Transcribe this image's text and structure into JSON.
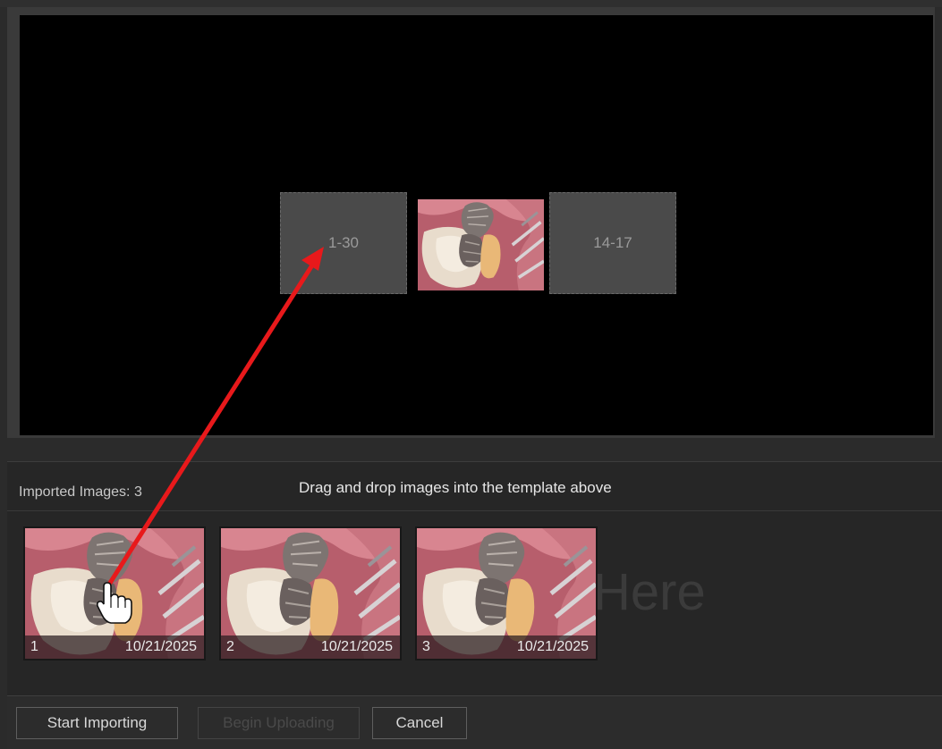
{
  "template": {
    "slots": [
      {
        "label": "1-30"
      },
      {
        "label": "14-17"
      }
    ]
  },
  "imported": {
    "count_label": "Imported Images: 3",
    "hint": "Drag and drop images into the template above",
    "watermark": "Here",
    "thumbnails": [
      {
        "number": "1",
        "date": "10/21/2025"
      },
      {
        "number": "2",
        "date": "10/21/2025"
      },
      {
        "number": "3",
        "date": "10/21/2025"
      }
    ]
  },
  "footer": {
    "start_label": "Start Importing",
    "upload_label": "Begin Uploading",
    "cancel_label": "Cancel"
  },
  "colors": {
    "arrow": "#e8191b",
    "slot_fill": "#4a4a4a",
    "canvas": "#000000"
  }
}
